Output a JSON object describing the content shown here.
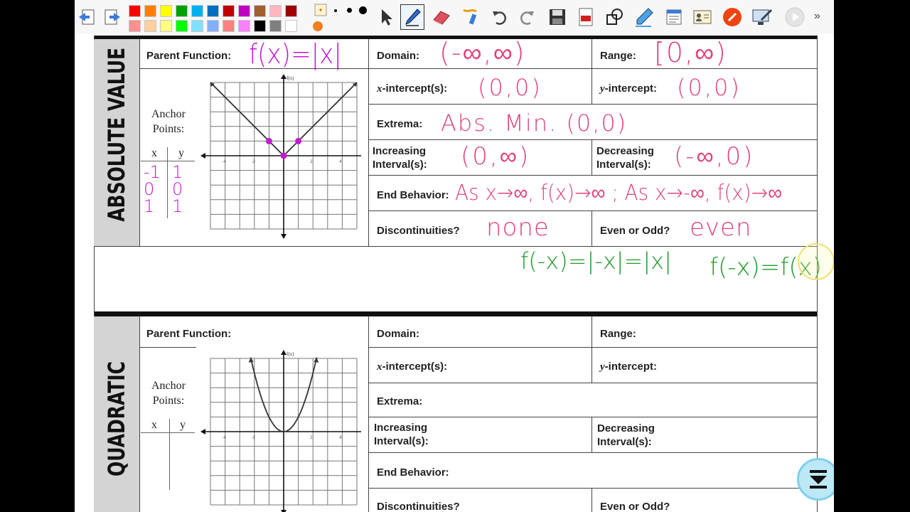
{
  "toolbar": {
    "colors_row1": [
      "#ff0000",
      "#ff8000",
      "#ffff00",
      "#00a000",
      "#00b0f0",
      "#0070c0",
      "#c00000",
      "#c000c0",
      "#a06030",
      "#ffb6c1",
      "#a00000"
    ],
    "colors_row2": [
      "#ff9090",
      "#ffd0a0",
      "#ffff80",
      "#00ff00",
      "#80e0ff",
      "#80b0ff",
      "#ff8080",
      "#ff80ff",
      "#000000",
      "#808080",
      "#ffffff"
    ],
    "tools": [
      "arrow-cursor",
      "pen",
      "eraser",
      "highlighter",
      "undo",
      "redo",
      "save",
      "pdf",
      "shapes",
      "marker",
      "notes",
      "contacts",
      "record",
      "screen-share",
      "play"
    ],
    "more_label": "»"
  },
  "section1": {
    "title": "ABSOLUTE VALUE",
    "parent_function_label": "Parent Function:",
    "parent_function_value": "f(x)=|x|",
    "anchor_label": "Anchor Points:",
    "table_x": "x",
    "table_y": "y",
    "anchors": [
      [
        "-1",
        "1"
      ],
      [
        "0",
        "0"
      ],
      [
        "1",
        "1"
      ]
    ],
    "graph_fx": "f(x)",
    "domain_label": "Domain:",
    "domain_value": "(-∞,∞)",
    "range_label": "Range:",
    "range_value": "[0,∞)",
    "xint_label_pre": "x",
    "xint_label_post": "-intercept(s):",
    "xint_value": "(0,0)",
    "yint_label_pre": "y",
    "yint_label_post": "-intercept:",
    "yint_value": "(0,0)",
    "extrema_label": "Extrema:",
    "extrema_value": "Abs. Min. (0,0)",
    "increasing_label": "Increasing Interval(s):",
    "increasing_value": "(0,∞)",
    "decreasing_label": "Decreasing Interval(s):",
    "decreasing_value": "(-∞,0)",
    "end_label": "End Behavior:",
    "end_value": "As x→∞, f(x)→∞ ; As x→-∞, f(x)→∞",
    "disc_label": "Discontinuities?",
    "disc_value": "none",
    "evenodd_label": "Even or Odd?",
    "evenodd_value": "even",
    "note1": "f(-x)=|-x|=|x|",
    "note2": "f(-x)=f(x)"
  },
  "section2": {
    "title": "QUADRATIC",
    "parent_function_label": "Parent Function:",
    "anchor_label": "Anchor Points:",
    "table_x": "x",
    "table_y": "y",
    "graph_fx": "f(x)",
    "domain_label": "Domain:",
    "range_label": "Range:",
    "xint_label_pre": "x",
    "xint_label_post": "-intercept(s):",
    "yint_label_pre": "y",
    "yint_label_post": "-intercept:",
    "extrema_label": "Extrema:",
    "increasing_label": "Increasing Interval(s):",
    "decreasing_label": "Decreasing Interval(s):",
    "end_label": "End Behavior:",
    "disc_label": "Discontinuities?",
    "evenodd_label": "Even or Odd?"
  },
  "graph_ticks": [
    "-4",
    "-2",
    "2",
    "4"
  ],
  "scroll_button_icon": "scroll-down-icon"
}
